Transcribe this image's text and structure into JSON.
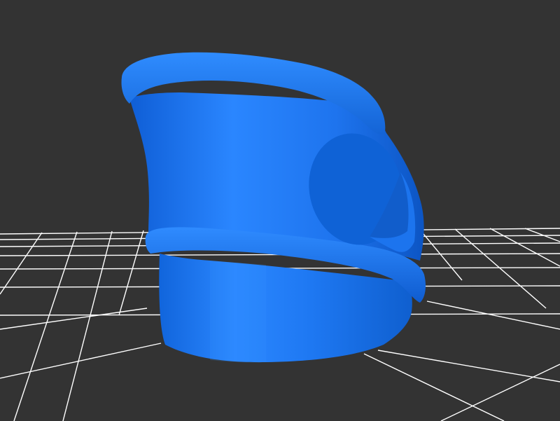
{
  "viewer": {
    "background_color": "#333333",
    "grid_color": "#ffffff",
    "model_color": "#1a6fe6",
    "model_highlight": "#2f8cff",
    "model_shadow": "#0b4fb8",
    "grid": "on"
  }
}
